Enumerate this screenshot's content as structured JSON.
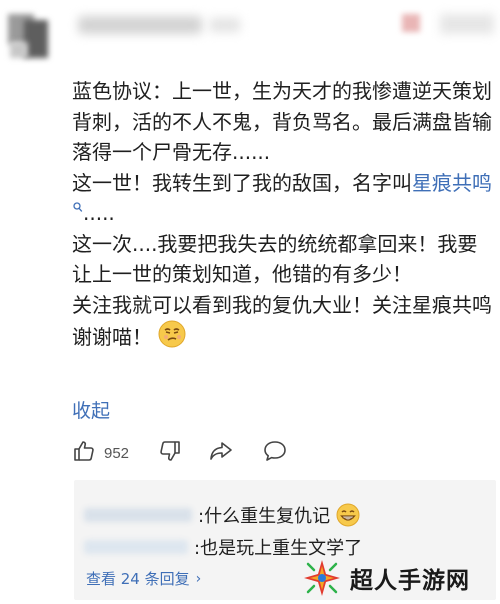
{
  "post": {
    "paragraphs": [
      {
        "parts": [
          {
            "text": "蓝色协议：上一世，生为天才的我惨遭逆天策划背刺，活的不人不鬼，背负骂名。最后满盘皆输落得一个尸骨无存......"
          }
        ]
      },
      {
        "parts": [
          {
            "text": "这一世！我转生到了我的敌国，名字叫"
          },
          {
            "text": "星痕共鸣",
            "link": true
          },
          {
            "text": "....."
          }
        ]
      },
      {
        "parts": [
          {
            "text": "这一次....我要把我失去的统统都拿回来！我要让上一世的策划知道，他错的有多少！"
          }
        ]
      },
      {
        "parts": [
          {
            "text": "关注我就可以看到我的复仇大业！关注星痕共鸣谢谢喵！"
          }
        ]
      }
    ],
    "collapse_label": "收起"
  },
  "actions": {
    "like_count": "952"
  },
  "replies": {
    "items": [
      {
        "text": ":什么重生复仇记"
      },
      {
        "text": ":也是玩上重生文学了"
      }
    ],
    "view_more_label": "查看 24 条回复",
    "view_more_chevron": "›"
  },
  "watermark": {
    "text": "超人手游网"
  },
  "colors": {
    "link": "#3f6fb7",
    "text": "#1f1f1f",
    "reply_bg": "#f4f4f4"
  },
  "icons": {
    "search": "search-icon",
    "like": "thumbs-up-icon",
    "dislike": "thumbs-down-icon",
    "share": "share-arrow-icon",
    "comment": "comment-bubble-icon",
    "emoji_post": "smirk-emoji-icon",
    "emoji_reply": "grin-emoji-icon"
  }
}
